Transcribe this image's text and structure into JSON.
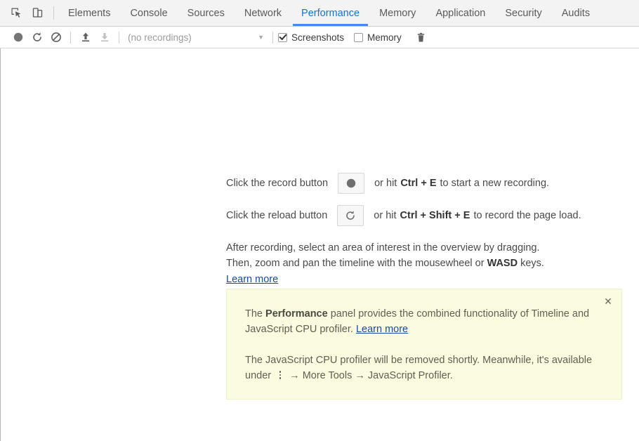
{
  "tabbar": {
    "inspect_icon": "inspect-element-icon",
    "device_icon": "device-toolbar-icon",
    "tabs": [
      {
        "label": "Elements",
        "active": false
      },
      {
        "label": "Console",
        "active": false
      },
      {
        "label": "Sources",
        "active": false
      },
      {
        "label": "Network",
        "active": false
      },
      {
        "label": "Performance",
        "active": true
      },
      {
        "label": "Memory",
        "active": false
      },
      {
        "label": "Application",
        "active": false
      },
      {
        "label": "Security",
        "active": false
      },
      {
        "label": "Audits",
        "active": false
      }
    ],
    "active_tab": "Performance",
    "accent_color": "#4688f1"
  },
  "toolbar": {
    "record_icon": "record-icon",
    "reload_icon": "reload-icon",
    "clear_icon": "clear-icon",
    "load_icon": "load-profile-icon",
    "save_icon": "save-profile-icon",
    "recordings_value": "(no recordings)",
    "recordings_caret": "▼",
    "screenshots_label": "Screenshots",
    "screenshots_checked": true,
    "memory_label": "Memory",
    "memory_checked": false,
    "trash_icon": "trash-icon"
  },
  "landing": {
    "record_hint_prefix": "Click the record button",
    "record_hint_mid": "or hit",
    "record_hint_keys": "Ctrl + E",
    "record_hint_suffix": "to start a new recording.",
    "reload_hint_prefix": "Click the reload button",
    "reload_hint_mid": "or hit",
    "reload_hint_keys": "Ctrl + Shift + E",
    "reload_hint_suffix": "to record the page load.",
    "desc_line1": "After recording, select an area of interest in the overview by dragging.",
    "desc_line2_a": "Then, zoom and pan the timeline with the mousewheel or",
    "desc_line2_keys": "WASD",
    "desc_line2_b": "keys.",
    "learn_more": "Learn more",
    "link_color": "#1a4ba0"
  },
  "banner": {
    "p1_a": "The",
    "p1_bold": "Performance",
    "p1_b": "panel provides the combined functionality of Timeline and JavaScript CPU profiler.",
    "p1_link": "Learn more",
    "p2_a": "The JavaScript CPU profiler will be removed shortly. Meanwhile, it's available under",
    "p2_arrow1": "→",
    "p2_more_tools": "More Tools",
    "p2_arrow2": "→",
    "p2_b": "JavaScript Profiler.",
    "close_label": "✕",
    "background_color": "#fbfbe0",
    "kebab_icon": "more-options-kebab-icon"
  }
}
